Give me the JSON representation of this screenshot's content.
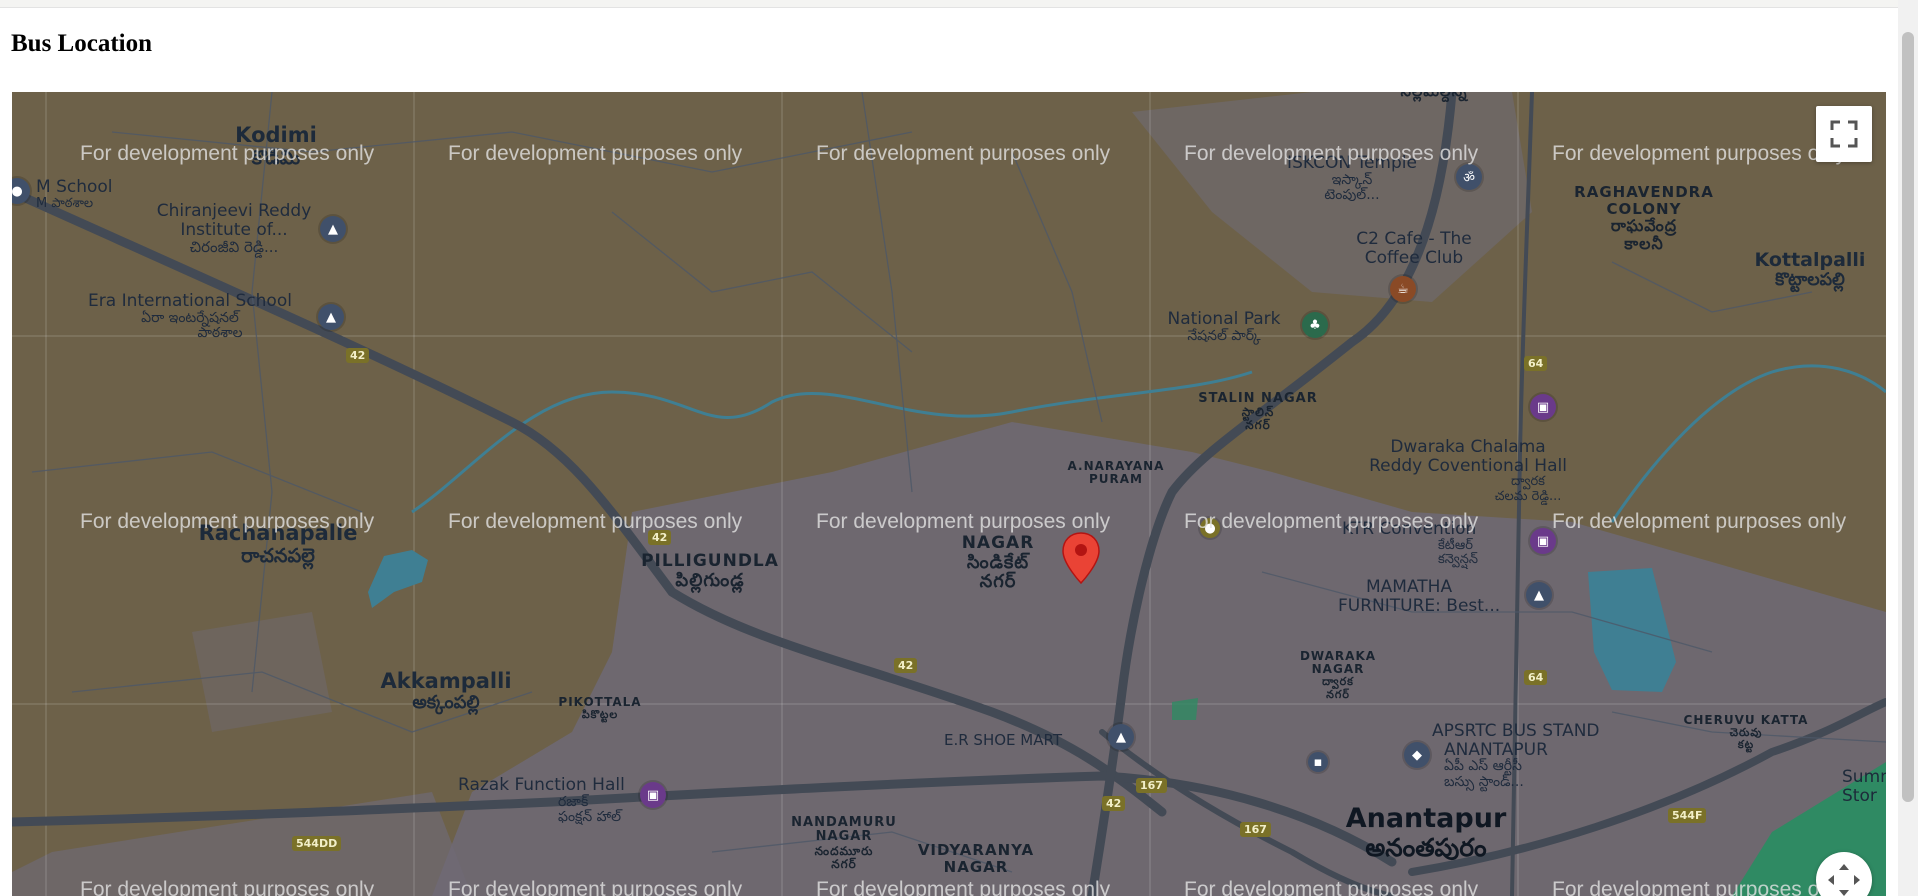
{
  "page": {
    "heading": "Bus Location"
  },
  "map": {
    "watermark": "For development purposes only",
    "marker": {
      "icon": "red-pin-icon",
      "color": "#ea4335"
    },
    "controls": {
      "fullscreen_icon": "fullscreen-icon",
      "camera_icon": "camera-control-icon"
    },
    "colors": {
      "land": "#6d6149",
      "urban": "#6f6a75",
      "water": "#3f7f93",
      "roads": "#434a55",
      "park": "#2f8a63"
    },
    "labels": {
      "kodimi": {
        "en": "Kodimi",
        "te": "కొడిమి"
      },
      "m_school": {
        "en": "M School",
        "te": "M పాఠశాల"
      },
      "chiranjeevi": {
        "en": "Chiranjeevi Reddy",
        "en2": "Institute of...",
        "te": "చిరంజీవి రెడ్డి..."
      },
      "era_school": {
        "en": "Era International School",
        "te": "ఏరా ఇంటర్నేషనల్",
        "te2": "పాఠశాల"
      },
      "rachanapalle": {
        "en": "Rachanapalle",
        "te": "రాచనపల్లె"
      },
      "pilligundla": {
        "en": "PILLIGUNDLA",
        "te": "పిల్లిగుండ్ల"
      },
      "akkampalli": {
        "en": "Akkampalli",
        "te": "అక్కంపల్లి"
      },
      "pikottala": {
        "en": "PIKOTTALA",
        "te": "పికొట్టల"
      },
      "razak": {
        "en": "Razak Function Hall",
        "te": "రజాక్",
        "te2": "ఫంక్షన్ హాల్"
      },
      "nandamuru": {
        "en": "NANDAMURU",
        "en2": "NAGAR",
        "te": "నందమూరు",
        "te2": "నగర్"
      },
      "vidyaranya": {
        "en": "VIDYARANYA",
        "en2": "NAGAR"
      },
      "syndicate": {
        "en": "NAGAR",
        "te": "సిండికేట్",
        "te2": "నగర్"
      },
      "narayana": {
        "en": "A.NARAYANA",
        "en2": "PURAM"
      },
      "stalin": {
        "en": "STALIN NAGAR",
        "te": "స్టాలిన్",
        "te2": "నగర్"
      },
      "national_park": {
        "en": "National Park",
        "te": "నేషనల్ పార్క్"
      },
      "c2_cafe": {
        "en": "C2 Cafe - The",
        "en2": "Coffee Club"
      },
      "iskcon": {
        "en": "ISKCON Temple",
        "te": "ఇస్కాన్",
        "te2": "టెంపుల్..."
      },
      "nalamuldu": {
        "en": "",
        "te": "నల్లమల్దిన్న"
      },
      "raghavendra": {
        "en": "RAGHAVENDRA",
        "en2": "COLONY",
        "te": "రాఘవేంద్ర",
        "te2": "కాలనీ"
      },
      "kottalpalli": {
        "en": "Kottalpalli",
        "te": "కొట్టాలపల్లి"
      },
      "dwaraka_hall": {
        "en": "Dwaraka Chalama",
        "en2": "Reddy Coventional Hall",
        "te": "ద్వారక",
        "te2": "చలమ రెడ్డి..."
      },
      "ktr": {
        "en": "KTR Convention",
        "te": "కేటీఆర్",
        "te2": "కన్వెన్షన్"
      },
      "mamatha": {
        "en": "MAMATHA",
        "en2": "FURNITURE: Best..."
      },
      "dwaraka_nagar": {
        "en": "DWARAKA",
        "en2": "NAGAR",
        "te": "ద్వారక",
        "te2": "నగర్"
      },
      "er_shoe": {
        "en": "E.R SHOE MART"
      },
      "apsrtc": {
        "en": "APSRTC BUS STAND",
        "en2": "ANANTAPUR",
        "te": "ఏపీ ఎస్ ఆర్టీసీ",
        "te2": "బస్సు స్టాండ్..."
      },
      "cheruvu": {
        "en": "CHERUVU KATTA",
        "te": "చెరువు",
        "te2": "కట్ట"
      },
      "anantapur": {
        "en": "Anantapur",
        "te": "అనంతపురం"
      },
      "summit": {
        "en": "Summ",
        "en2": "Stor"
      }
    },
    "road_shields": [
      "42",
      "42",
      "42",
      "42",
      "544DD",
      "167",
      "167",
      "64",
      "64",
      "544F"
    ]
  }
}
